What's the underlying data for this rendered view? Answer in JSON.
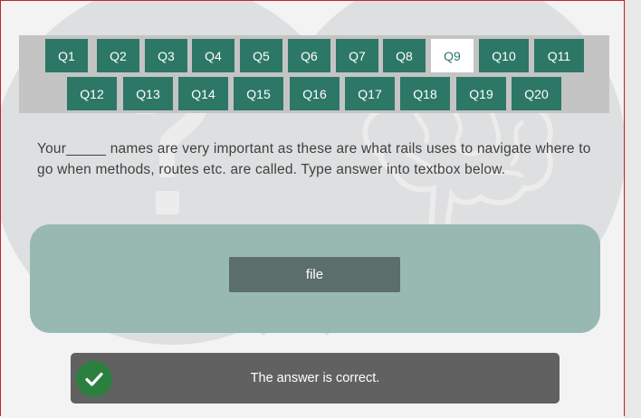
{
  "questions": [
    {
      "label": "Q1"
    },
    {
      "label": "Q2"
    },
    {
      "label": "Q3"
    },
    {
      "label": "Q4"
    },
    {
      "label": "Q5"
    },
    {
      "label": "Q6"
    },
    {
      "label": "Q7"
    },
    {
      "label": "Q8"
    },
    {
      "label": "Q9"
    },
    {
      "label": "Q10"
    },
    {
      "label": "Q11"
    },
    {
      "label": "Q12"
    },
    {
      "label": "Q13"
    },
    {
      "label": "Q14"
    },
    {
      "label": "Q15"
    },
    {
      "label": "Q16"
    },
    {
      "label": "Q17"
    },
    {
      "label": "Q18"
    },
    {
      "label": "Q19"
    },
    {
      "label": "Q20"
    }
  ],
  "active_question": "Q9",
  "question_text": "Your_____ names are very important as these are what rails uses to navigate where to go when methods, routes etc. are called. Type answer into textbox below.",
  "answer": {
    "value": "file"
  },
  "feedback": {
    "text": "The answer is correct.",
    "status": "correct"
  },
  "colors": {
    "accent": "#2d7767",
    "answer_panel": "#97b9b2",
    "feedback_bg": "#616161",
    "success": "#2b8040"
  },
  "icons": {
    "feedback": "check-circle-icon",
    "background_left": "question-mark-icon",
    "background_right": "brain-icon"
  }
}
